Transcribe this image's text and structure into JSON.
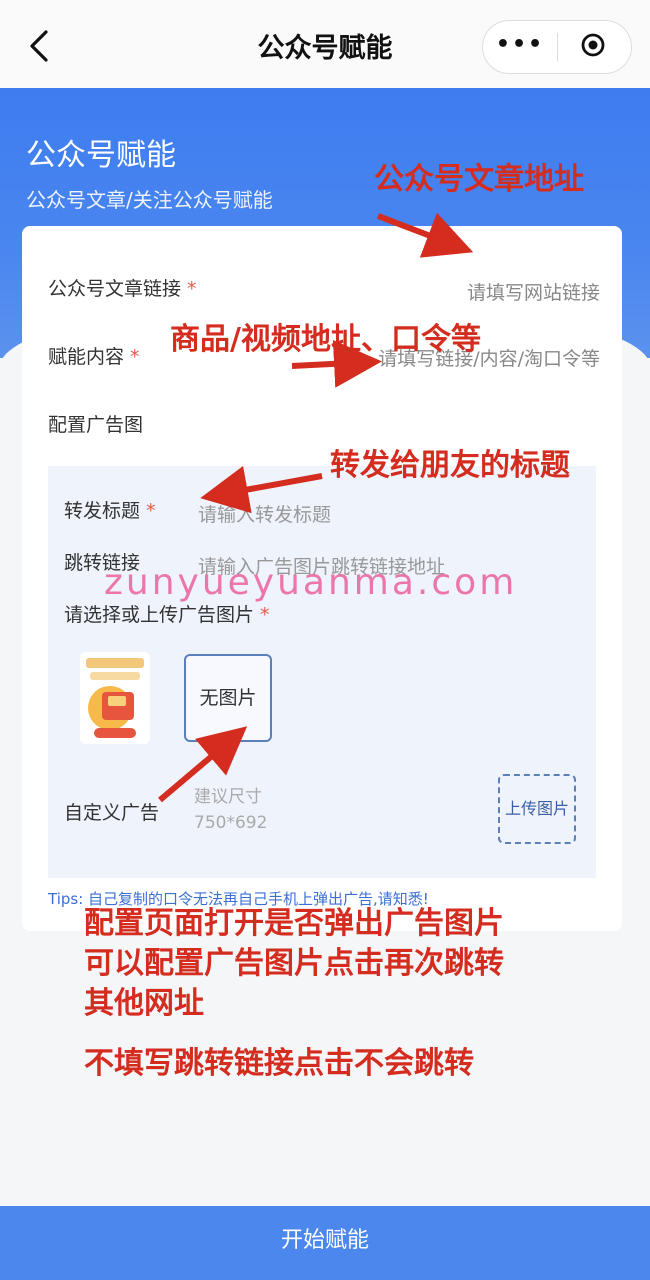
{
  "nav": {
    "title": "公众号赋能",
    "more_icon": "more-dots-icon",
    "target_icon": "target-icon",
    "back_icon": "chevron-left-icon"
  },
  "hero": {
    "title": "公众号赋能",
    "subtitle": "公众号文章/关注公众号赋能"
  },
  "form": {
    "article_link": {
      "label": "公众号文章链接",
      "required": "*",
      "placeholder": "请填写网站链接"
    },
    "content": {
      "label": "赋能内容",
      "required": "*",
      "placeholder": "请填写链接/内容/淘口令等"
    },
    "ad_config": {
      "label": "配置广告图"
    },
    "share_title": {
      "label": "转发标题",
      "required": "*",
      "placeholder": "请输入转发标题"
    },
    "jump_link": {
      "label": "跳转链接",
      "placeholder": "请输入广告图片跳转链接地址"
    },
    "choose_image": {
      "label": "请选择或上传广告图片",
      "required": "*"
    },
    "no_image": "无图片",
    "custom_ad": {
      "label": "自定义广告",
      "suggest_line1": "建议尺寸",
      "suggest_line2": "750*692",
      "upload": "上传图片"
    },
    "tips": "Tips: 自己复制的口令无法再自己手机上弹出广告,请知悉!"
  },
  "annotations": {
    "a1": "公众号文章地址",
    "a2": "商品/视频地址、口令等",
    "a3": "转发给朋友的标题",
    "a4_lines": [
      "配置页面打开是否弹出广告图片",
      "可以配置广告图片点击再次跳转",
      "其他网址"
    ],
    "a5": "不填写跳转链接点击不会跳转"
  },
  "watermark": "zunyueyuanma.com",
  "bottom_button": "开始赋能",
  "colors": {
    "primary": "#4c87ee",
    "annotation_red": "#d42c1f",
    "required_red": "#e55a4a"
  }
}
